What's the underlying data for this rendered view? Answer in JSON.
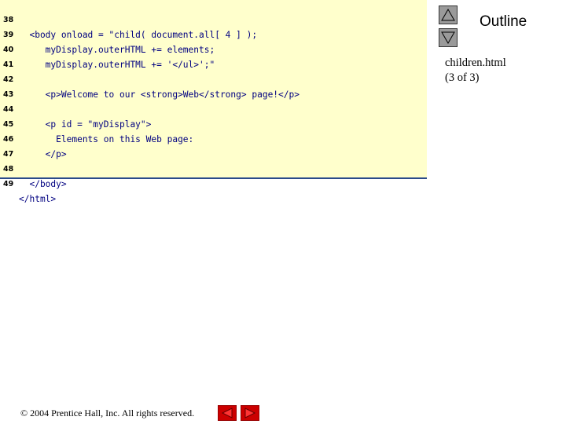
{
  "code_lines": [
    {
      "num": "38",
      "text": "  <body onload = \"child( document.all[ 4 ] );"
    },
    {
      "num": "39",
      "text": "     myDisplay.outerHTML += elements;"
    },
    {
      "num": "40",
      "text": "     myDisplay.outerHTML += '</ul>';\""
    },
    {
      "num": "41",
      "text": ""
    },
    {
      "num": "42",
      "text": "     <p>Welcome to our <strong>Web</strong> page!</p>"
    },
    {
      "num": "43",
      "text": ""
    },
    {
      "num": "44",
      "text": "     <p id = \"myDisplay\">"
    },
    {
      "num": "45",
      "text": "       Elements on this Web page:"
    },
    {
      "num": "46",
      "text": "     </p>"
    },
    {
      "num": "47",
      "text": ""
    },
    {
      "num": "48",
      "text": "  </body>"
    },
    {
      "num": "49",
      "text": "</html>"
    }
  ],
  "outline": {
    "title": "Outline",
    "file_name": "children.html",
    "page_info": "(3 of 3)"
  },
  "footer": {
    "copyright": "© 2004 Prentice Hall, Inc.  All rights reserved."
  },
  "icons": {
    "up": "up-triangle-icon",
    "down": "down-triangle-icon",
    "prev": "previous-slide-icon",
    "next": "next-slide-icon"
  }
}
